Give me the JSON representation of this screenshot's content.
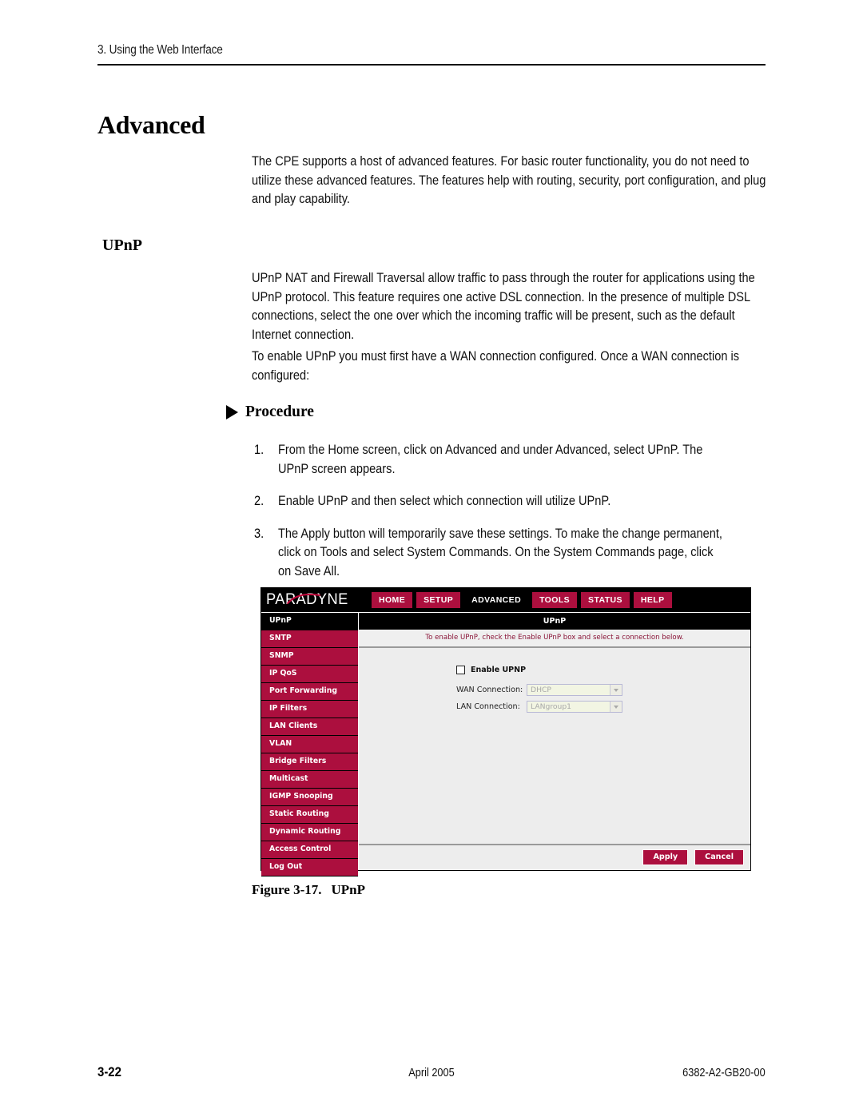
{
  "page": {
    "running_head": "3. Using the Web Interface",
    "section_title": "Advanced",
    "subsection_title": "UPnP"
  },
  "paragraphs": {
    "advanced_intro": "The CPE supports a host of advanced features. For basic router functionality, you do not need to utilize these advanced features. The features help with routing, security, port configuration, and plug and play capability.",
    "upnp_1": "UPnP NAT and Firewall Traversal allow traffic to pass through the router for applications using the UPnP protocol. This feature requires one active DSL connection. In the presence of multiple DSL connections, select the one over which the incoming traffic will be present, such as the default Internet connection.",
    "upnp_2": "To enable UPnP you must first have a WAN connection configured. Once a WAN connection is configured:"
  },
  "procedure": {
    "heading": "Procedure",
    "steps": [
      {
        "number": "1.",
        "text": "From the Home screen, click on Advanced and under Advanced, select UPnP. The UPnP screen appears."
      },
      {
        "number": "2.",
        "text": "Enable UPnP and then select which connection will utilize UPnP."
      },
      {
        "number": "3.",
        "text": "The Apply button will temporarily save these settings. To make the change permanent, click on Tools and select System Commands. On the System Commands page, click on Save All."
      }
    ]
  },
  "figure": {
    "label": "Figure 3-17.",
    "title": "UPnP"
  },
  "router_ui": {
    "brand": "PARADYNE",
    "nav_tabs": [
      {
        "label": "HOME",
        "active": false
      },
      {
        "label": "SETUP",
        "active": false
      },
      {
        "label": "ADVANCED",
        "active": true
      },
      {
        "label": "TOOLS",
        "active": false
      },
      {
        "label": "STATUS",
        "active": false
      },
      {
        "label": "HELP",
        "active": false
      }
    ],
    "sidebar": [
      {
        "label": "UPnP",
        "active": true
      },
      {
        "label": "SNTP",
        "active": false
      },
      {
        "label": "SNMP",
        "active": false
      },
      {
        "label": "IP QoS",
        "active": false
      },
      {
        "label": "Port Forwarding",
        "active": false
      },
      {
        "label": "IP Filters",
        "active": false
      },
      {
        "label": "LAN Clients",
        "active": false
      },
      {
        "label": "VLAN",
        "active": false
      },
      {
        "label": "Bridge Filters",
        "active": false
      },
      {
        "label": "Multicast",
        "active": false
      },
      {
        "label": "IGMP Snooping",
        "active": false
      },
      {
        "label": "Static Routing",
        "active": false
      },
      {
        "label": "Dynamic Routing",
        "active": false
      },
      {
        "label": "Access Control",
        "active": false
      },
      {
        "label": "Log Out",
        "active": false
      }
    ],
    "panel": {
      "title": "UPnP",
      "description": "To enable UPnP, check the Enable UPnP box and select a connection below.",
      "enable_label": "Enable UPNP",
      "enable_checked": false,
      "wan_label": "WAN Connection:",
      "wan_value": "DHCP",
      "lan_label": "LAN Connection:",
      "lan_value": "LANgroup1",
      "apply_label": "Apply",
      "cancel_label": "Cancel"
    },
    "colors": {
      "brand_red": "#AC0F3E",
      "panel_bg": "#EDEDED",
      "desc_text": "#8A1538",
      "select_bg": "#F2F5E3"
    }
  },
  "footer": {
    "page_number": "3-22",
    "date": "April 2005",
    "doc_number": "6382-A2-GB20-00"
  }
}
